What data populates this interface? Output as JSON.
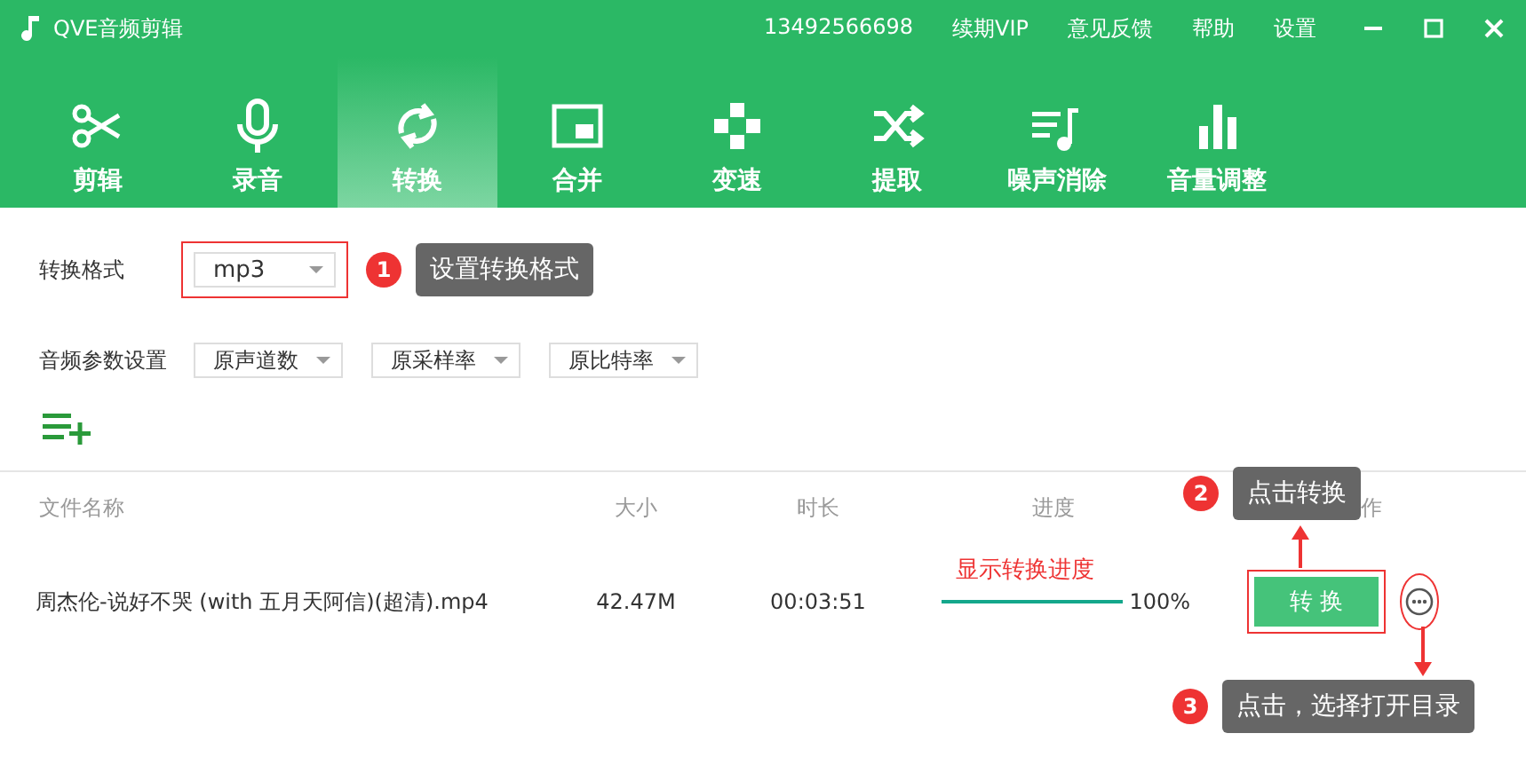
{
  "window": {
    "title": "QVE音频剪辑"
  },
  "header_links": [
    "13492566698",
    "续期VIP",
    "意见反馈",
    "帮助",
    "设置"
  ],
  "tabs": [
    {
      "label": "剪辑",
      "kind": "scissors",
      "selected": false
    },
    {
      "label": "录音",
      "kind": "mic",
      "selected": false
    },
    {
      "label": "转换",
      "kind": "convert",
      "selected": true
    },
    {
      "label": "合并",
      "kind": "merge",
      "selected": false
    },
    {
      "label": "变速",
      "kind": "speed",
      "selected": false
    },
    {
      "label": "提取",
      "kind": "shuffle",
      "selected": false
    },
    {
      "label": "噪声消除",
      "kind": "noise",
      "selected": false
    },
    {
      "label": "音量调整",
      "kind": "volume",
      "selected": false
    }
  ],
  "format": {
    "label": "转换格式",
    "value": "mp3"
  },
  "audio_params": {
    "label": "音频参数设置",
    "selects": [
      "原声道数",
      "原采样率",
      "原比特率"
    ]
  },
  "table": {
    "columns": [
      "文件名称",
      "大小",
      "时长",
      "进度",
      "作"
    ],
    "rows": [
      {
        "name": "周杰伦-说好不哭 (with 五月天阿信)(超清).mp4",
        "size": "42.47M",
        "duration": "00:03:51",
        "level": 1,
        "percent": "100%",
        "button": "转 换"
      }
    ]
  },
  "annotations": [
    {
      "number": "1",
      "text": "设置转换格式"
    },
    {
      "number": "2",
      "text": "点击转换"
    },
    {
      "number": "3",
      "text": "点击，选择打开目录"
    }
  ],
  "progress_note": "显示转换进度"
}
